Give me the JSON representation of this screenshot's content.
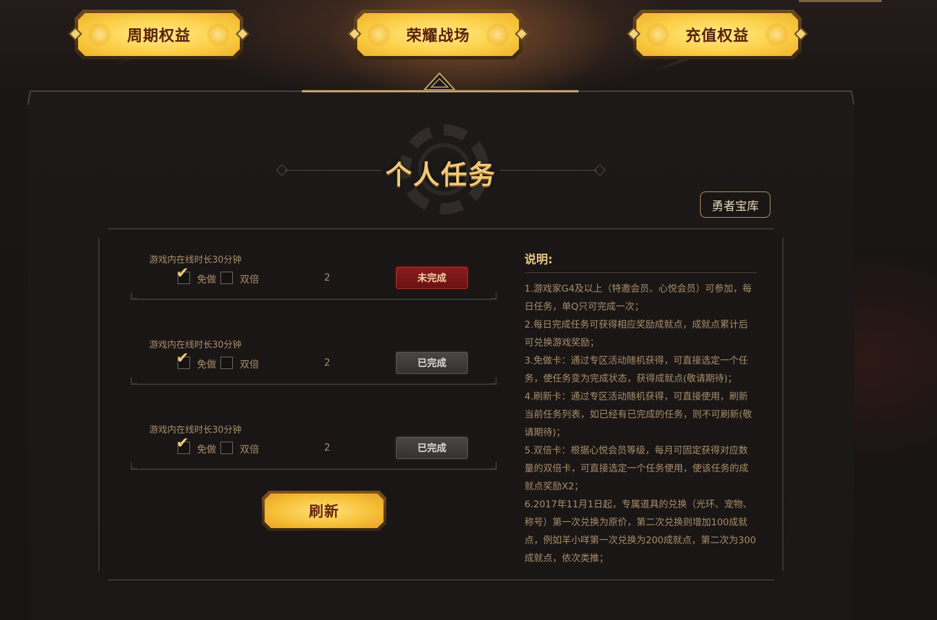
{
  "tabs": [
    {
      "label": "周期权益",
      "active": false
    },
    {
      "label": "荣耀战场",
      "active": true
    },
    {
      "label": "充值权益",
      "active": false
    }
  ],
  "section_title": "个人任务",
  "vault_button": "勇者宝库",
  "tasks": [
    {
      "name": "游戏内在线时长30分钟",
      "option1": "免做",
      "option1_checked": true,
      "option2": "双倍",
      "option2_checked": false,
      "count": "2",
      "status": "未完成"
    },
    {
      "name": "游戏内在线时长30分钟",
      "option1": "免做",
      "option1_checked": true,
      "option2": "双倍",
      "option2_checked": false,
      "count": "2",
      "status": "已完成"
    },
    {
      "name": "游戏内在线时长30分钟",
      "option1": "免做",
      "option1_checked": true,
      "option2": "双倍",
      "option2_checked": false,
      "count": "2",
      "status": "已完成"
    }
  ],
  "refresh_button": "刷新",
  "check_glyph": "✔",
  "description": {
    "heading": "说明:",
    "lines": [
      "1.游戏家G4及以上（特邀会员、心悦会员）可参加，每日任务，单Q只可完成一次；",
      "2.每日完成任务可获得相应奖励成就点，成就点累计后可兑换游戏奖励；",
      "3.免做卡：通过专区活动随机获得，可直接选定一个任务，使任务变为完成状态，获得成就点(敬请期待)；",
      "4.刷新卡：通过专区活动随机获得，可直接使用，刷新当前任务列表，如已经有已完成的任务，则不可刷新(敬请期待)；",
      "5.双倍卡：根据心悦会员等级，每月可固定获得对应数量的双倍卡，可直接选定一个任务使用，使该任务的成就点奖励X2；",
      "6.2017年11月1日起，专属道具的兑换（光环、宠物、称号）第一次兑换为原价，第二次兑换则增加100成就点，例如羊小咩第一次兑换为200成就点，第二次为300成就点，依次类推；"
    ]
  },
  "colors": {
    "accent_gold": "#f0c878",
    "status_todo": "#8a1c1c",
    "status_done": "#4a4746",
    "text_muted": "#a88e68"
  }
}
